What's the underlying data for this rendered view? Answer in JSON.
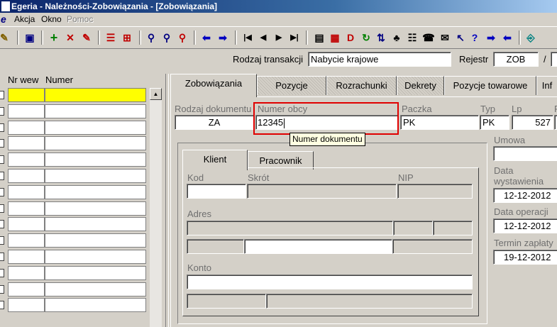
{
  "window": {
    "title": "Egeria - Należności-Zobowiązania - [Zobowiązania]"
  },
  "menu": {
    "items": [
      "Akcja",
      "Okno",
      "Pomoc"
    ]
  },
  "toolbar": {
    "icons": [
      "pin-icon",
      "save-icon",
      "add-icon",
      "delete-icon",
      "edit-icon",
      "split-h-icon",
      "split-v-icon",
      "search-icon",
      "search-next-icon",
      "search-reset-icon",
      "prev-icon",
      "next-icon",
      "first-icon",
      "previous-icon",
      "play-icon",
      "last-icon",
      "report-icon",
      "print-icon",
      "document-d-icon",
      "refresh-icon",
      "sort-icon",
      "tree-icon",
      "phone-icon",
      "mail-icon",
      "arrow-cursor-icon",
      "help-icon",
      "back-arrow-icon",
      "forward-arrow-icon",
      "exit-icon"
    ]
  },
  "header": {
    "transaction_type_label": "Rodzaj transakcji",
    "transaction_type_value": "Nabycie krajowe",
    "register_label": "Rejestr",
    "register_value": "ZOB",
    "separator": "/"
  },
  "grid": {
    "columns": [
      "Nr wew",
      "Numer"
    ],
    "row_count": 16,
    "selected_row": 0
  },
  "tabs": [
    "Zobowiązania",
    "Pozycje",
    "Rozrachunki",
    "Dekrety",
    "Pozycje towarowe",
    "Inf"
  ],
  "active_tab": "Zobowiązania",
  "document": {
    "doc_type_label": "Rodzaj dokumentu",
    "doc_type_value": "ZA",
    "external_number_label": "Numer obcy",
    "external_number_value": "12345",
    "batch_label": "Paczka",
    "batch_value": "PK",
    "type_label": "Typ",
    "type_value": "PK",
    "lp_label": "Lp",
    "lp_value": "527",
    "extra_label": "R"
  },
  "tooltip": "Numer dokumentu",
  "inner_tabs": [
    "Klient",
    "Pracownik"
  ],
  "client": {
    "code_label": "Kod",
    "short_label": "Skrót",
    "nip_label": "NIP",
    "address_label": "Adres",
    "account_label": "Konto"
  },
  "right": {
    "contract_label": "Umowa",
    "issue_date_label_1": "Data",
    "issue_date_label_2": "wystawienia",
    "issue_date_value": "12-12-2012",
    "op_date_label": "Data operacji",
    "op_date_value": "12-12-2012",
    "due_date_label": "Termin zapłaty",
    "due_date_value": "19-12-2012"
  },
  "colors": {
    "selection": "#ffff00",
    "highlight": "#e00000",
    "titlebar": "#0a246a"
  }
}
